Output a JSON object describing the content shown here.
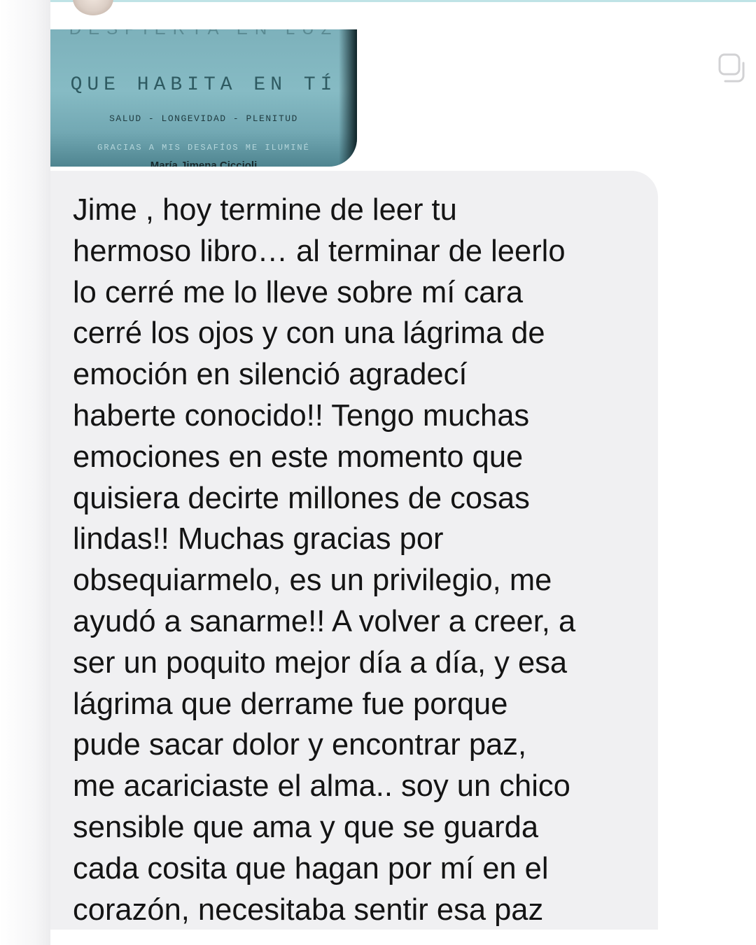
{
  "book_cover": {
    "top_text": "DESPIERTA EN LUZ",
    "title": "QUE HABITA EN TÍ",
    "subtitle": "SALUD - LONGEVIDAD - PLENITUD",
    "quote": "GRACIAS A MIS DESAFÍOS ME ILUMINÉ",
    "author": "María Jimena Ciccioli"
  },
  "icons": [
    "avatar",
    "copy-icon"
  ],
  "message": {
    "lines": [
      "Jime , hoy termine de leer tu",
      "hermoso libro… al terminar de leerlo",
      "lo cerré me lo lleve sobre mí cara",
      "cerré los ojos y con una lágrima de",
      "emoción en silenció agradecí",
      "haberte conocido!! Tengo muchas",
      "emociones en este momento que",
      "quisiera decirte millones de cosas",
      "lindas!! Muchas gracias por",
      "obsequiarmelo, es un privilegio,  me",
      "ayudó a sanarme!! A volver a creer, a",
      "ser un poquito mejor día a día, y esa",
      "lágrima que derrame fue porque",
      "pude sacar dolor y encontrar paz,",
      "me acariciaste el alma.. soy un chico",
      "sensible que ama y que se guarda",
      "cada cosita que hagan por mí en el",
      "corazón,  necesitaba sentir esa paz"
    ]
  }
}
